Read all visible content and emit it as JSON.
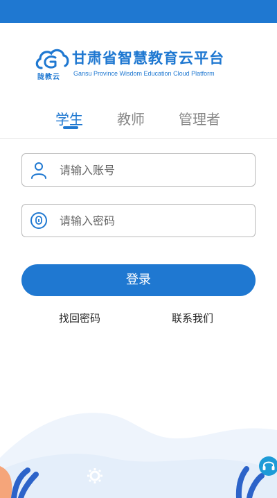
{
  "brand": {
    "badge": "陇教云",
    "title": "甘肃省智慧教育云平台",
    "subtitle": "Gansu Province Wisdom Education Cloud Platform",
    "accent_color": "#1f78d1"
  },
  "tabs": [
    {
      "label": "学生",
      "active": true
    },
    {
      "label": "教师",
      "active": false
    },
    {
      "label": "管理者",
      "active": false
    }
  ],
  "form": {
    "account": {
      "placeholder": "请输入账号",
      "value": "",
      "icon": "user-icon"
    },
    "password": {
      "placeholder": "请输入密码",
      "value": "",
      "icon": "lock-icon"
    },
    "login_label": "登录"
  },
  "links": {
    "forgot": "找回密码",
    "contact": "联系我们"
  },
  "support": {
    "icon": "headset-icon"
  }
}
